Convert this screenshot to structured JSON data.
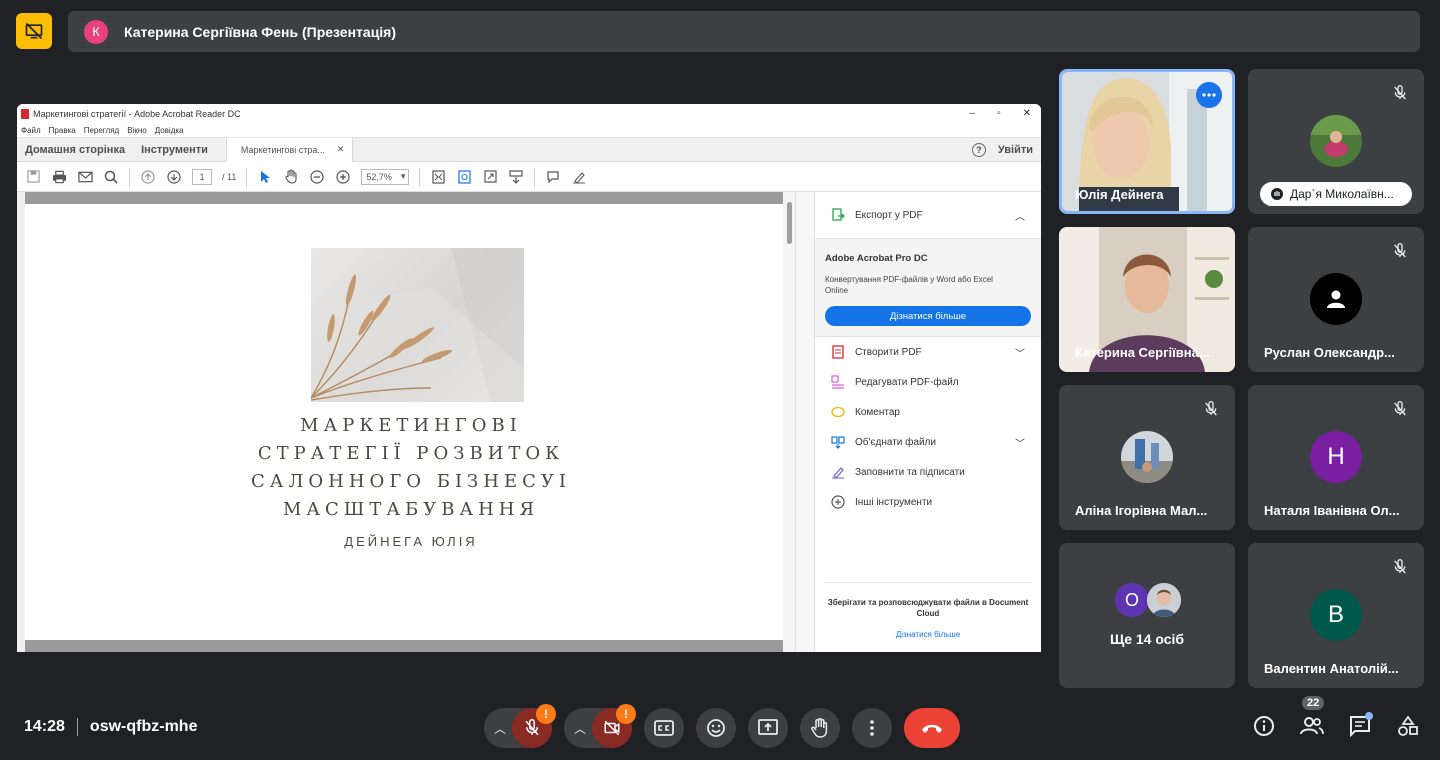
{
  "presenter": {
    "avatar_letter": "К",
    "title": "Катерина Сергіївна Фень (Презентація)"
  },
  "acrobat": {
    "window_title": "Маркетингові стратегії - Adobe Acrobat Reader DC",
    "menu": [
      "Файл",
      "Правка",
      "Перегляд",
      "Вікно",
      "Довідка"
    ],
    "tabs": {
      "home": "Домашня сторінка",
      "tools": "Інструменти",
      "doc": "Маркетингові стра..."
    },
    "signin": "Увійти",
    "help": "?",
    "page_current": "1",
    "page_total": "/ 11",
    "zoom": "52,7%",
    "slide": {
      "line1": "МАРКЕТИНГОВІ",
      "line2": "СТРАТЕГІЇ РОЗВИТОК",
      "line3": "САЛОННОГО БІЗНЕСУІ",
      "line4": "МАСШТАБУВАННЯ",
      "author": "ДЕЙНЕГА ЮЛІЯ"
    },
    "pane": {
      "export": "Експорт у PDF",
      "promo_title": "Adobe Acrobat Pro DC",
      "promo_desc": "Конвертування PDF-файлів у Word або Excel Online",
      "promo_btn": "Дізнатися більше",
      "tools": [
        "Створити PDF",
        "Редагувати PDF-файл",
        "Коментар",
        "Об'єднати файли",
        "Заповнити та підписати",
        "Інші інструменти"
      ],
      "cloud_text": "Зберігати та розповсюджувати файли в Document Cloud",
      "cloud_link": "Дізнатися більше"
    }
  },
  "participants": {
    "yulia": "Юлія Дейнега",
    "darya": "Дар`я Миколаївн...",
    "kateryna": "Катерина Сергіївна...",
    "ruslan": "Руслан Олександр...",
    "alina": "Аліна Ігорівна Мал...",
    "natalia": "Наталя Іванівна Ол...",
    "natalia_letter": "Н",
    "others_letter": "О",
    "others": "Ще 14 осіб",
    "valentyn": "Валентин Анатолій...",
    "valentyn_letter": "В"
  },
  "footer": {
    "time": "14:28",
    "meeting_code": "osw-qfbz-mhe",
    "people_count": "22",
    "warn": "!"
  },
  "colors": {
    "background": "#202124",
    "tile": "#3c4043",
    "end_call": "#ea4335",
    "present_yellow": "#fbbc04",
    "acrobat_blue": "#1473e6"
  }
}
